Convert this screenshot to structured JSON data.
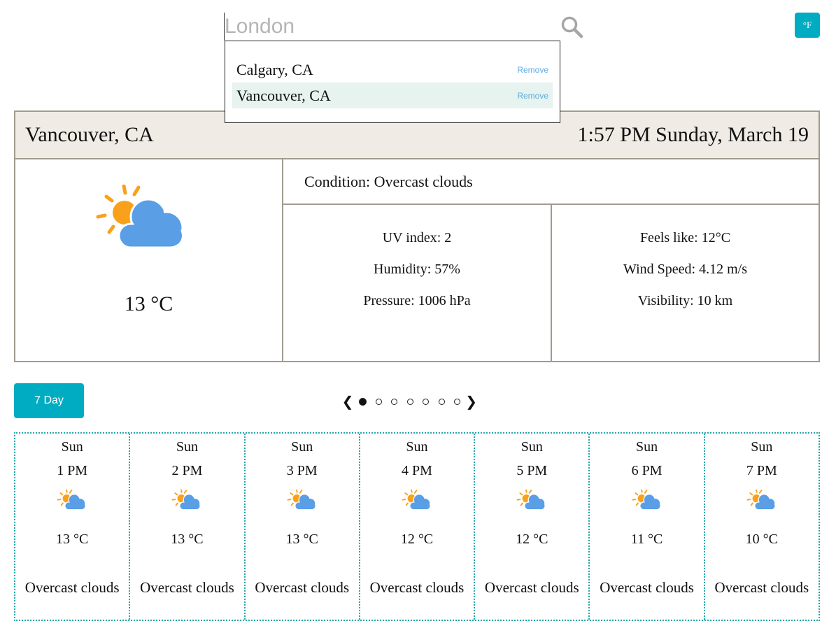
{
  "search": {
    "placeholder": "London"
  },
  "unit_toggle": {
    "label": "°F"
  },
  "dropdown": {
    "items": [
      {
        "name": "Calgary, CA",
        "remove_label": "Remove"
      },
      {
        "name": "Vancouver, CA",
        "remove_label": "Remove"
      }
    ]
  },
  "current": {
    "city": "Vancouver, CA",
    "datetime": "1:57 PM Sunday, March 19",
    "temp": "13 °C",
    "icon": "partly-cloudy-icon",
    "condition": "Condition: Overcast clouds",
    "uv": "UV index: 2",
    "humidity": "Humidity: 57%",
    "pressure": "Pressure: 1006 hPa",
    "feels_like": "Feels like: 12°C",
    "wind": "Wind Speed: 4.12 m/s",
    "visibility": "Visibility: 10 km"
  },
  "forecast_toggle": {
    "label": "7 Day"
  },
  "pager": {
    "prev": "❮",
    "next": "❯",
    "active_page": 1,
    "total_pages": 7
  },
  "hourly": [
    {
      "day": "Sun",
      "time": "1 PM",
      "temp": "13 °C",
      "condition": "Overcast clouds"
    },
    {
      "day": "Sun",
      "time": "2 PM",
      "temp": "13 °C",
      "condition": "Overcast clouds"
    },
    {
      "day": "Sun",
      "time": "3 PM",
      "temp": "13 °C",
      "condition": "Overcast clouds"
    },
    {
      "day": "Sun",
      "time": "4 PM",
      "temp": "12 °C",
      "condition": "Overcast clouds"
    },
    {
      "day": "Sun",
      "time": "5 PM",
      "temp": "12 °C",
      "condition": "Overcast clouds"
    },
    {
      "day": "Sun",
      "time": "6 PM",
      "temp": "11 °C",
      "condition": "Overcast clouds"
    },
    {
      "day": "Sun",
      "time": "7 PM",
      "temp": "10 °C",
      "condition": "Overcast clouds"
    }
  ],
  "colors": {
    "accent": "#00acc1",
    "header_bg": "#f0ebe4",
    "border": "#a39a8f",
    "sun": "#f9a11b",
    "cloud": "#5a9ee6",
    "remove_link": "#5dade2"
  }
}
